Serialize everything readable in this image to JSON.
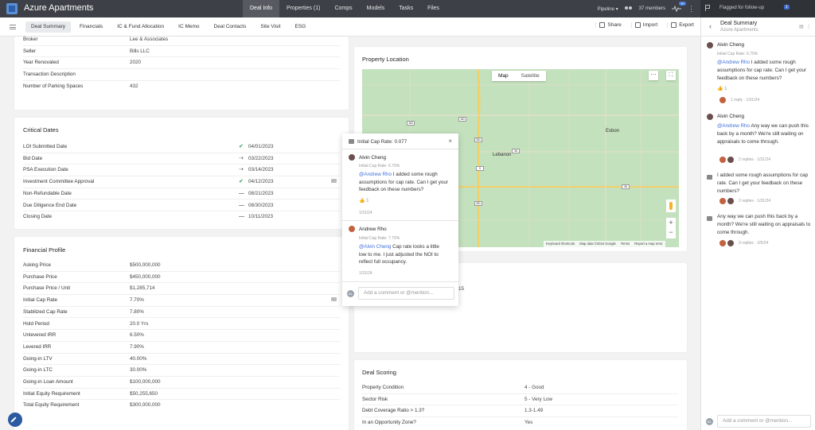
{
  "app": {
    "title": "Azure Apartments"
  },
  "nav": {
    "items": [
      "Deal Info",
      "Properties (1)",
      "Comps",
      "Models",
      "Tasks",
      "Files"
    ],
    "active": "Deal Info"
  },
  "topright": {
    "pipeline": "Pipeline",
    "members": "37 members",
    "notif_count": "9+"
  },
  "followup": {
    "label": "Flagged for follow-up",
    "count": "1"
  },
  "subnav": {
    "tabs": [
      "Deal Summary",
      "Financials",
      "IC & Fund Allocation",
      "IC Memo",
      "Deal Contacts",
      "Site Visit",
      "ESG"
    ],
    "active": "Deal Summary",
    "actions": [
      "Share",
      "Import",
      "Export"
    ]
  },
  "property_info": {
    "rows": [
      {
        "k": "Broker",
        "v": "Lee & Associates"
      },
      {
        "k": "Seller",
        "v": "Bills LLC"
      },
      {
        "k": "Year Renovated",
        "v": "2020"
      },
      {
        "k": "Transaction Description",
        "v": ""
      },
      {
        "k": "Number of Parking Spaces",
        "v": "432"
      }
    ]
  },
  "critical_dates": {
    "title": "Critical Dates",
    "rows": [
      {
        "k": "LOI Submitted Date",
        "status": "check",
        "v": "04/01/2023"
      },
      {
        "k": "Bid Date",
        "status": "arrow",
        "v": "03/22/2023"
      },
      {
        "k": "PSA Execution Date",
        "status": "arrow",
        "v": "03/14/2023"
      },
      {
        "k": "Investment Committee Approval",
        "status": "check",
        "v": "04/12/2023"
      },
      {
        "k": "Non-Refundable Date",
        "status": "dash",
        "v": "08/21/2023"
      },
      {
        "k": "Due Diligence End Date",
        "status": "dash",
        "v": "08/30/2023"
      },
      {
        "k": "Closing Date",
        "status": "dash",
        "v": "10/11/2023"
      }
    ]
  },
  "financial_profile": {
    "title": "Financial Profile",
    "rows": [
      {
        "k": "Asking Price",
        "v": "$500,000,000"
      },
      {
        "k": "Purchase Price",
        "v": "$450,000,000"
      },
      {
        "k": "Purchase Price / Unit",
        "v": "$1,285,714"
      },
      {
        "k": "Initial Cap Rate",
        "v": "7.70%"
      },
      {
        "k": "Stabilized Cap Rate",
        "v": "7.80%"
      },
      {
        "k": "Hold Period",
        "v": "20.0 Yrs"
      },
      {
        "k": "Unlevered IRR",
        "v": "6.50%"
      },
      {
        "k": "Levered IRR",
        "v": "7.90%"
      },
      {
        "k": "Going-in LTV",
        "v": "40.00%"
      },
      {
        "k": "Going-in LTC",
        "v": "30.00%"
      },
      {
        "k": "Going-in Loan Amount",
        "v": "$100,000,000"
      },
      {
        "k": "Initial Equity Requirement",
        "v": "$50,255,650"
      },
      {
        "k": "Total Equity Requirement",
        "v": "$300,000,000"
      }
    ]
  },
  "property_location": {
    "title": "Property Location",
    "toggle": [
      "Map",
      "Satellite"
    ],
    "towns": [
      "Lebanon",
      "Esbon"
    ],
    "shields": [
      "182",
      "181",
      "281",
      "36",
      "9",
      "36",
      "281"
    ],
    "footer": [
      "Keyboard shortcuts",
      "Map data ©2024 Google",
      "Terms",
      "Report a map error"
    ]
  },
  "hidden_card": {
    "partial_text": "15"
  },
  "deal_scoring": {
    "title": "Deal Scoring",
    "rows": [
      {
        "k": "Property Condition",
        "v": "4 - Good"
      },
      {
        "k": "Sector Risk",
        "v": "5 - Very Low"
      },
      {
        "k": "Debt Coverage Ratio > 1.3?",
        "v": "1.3-1.49"
      },
      {
        "k": "In an Opportunity Zone?",
        "v": "Yes"
      }
    ]
  },
  "popover": {
    "title": "Initial Cap Rate: 0.077",
    "comments": [
      {
        "name": "Alvin Cheng",
        "sub": "Initial Cap Rate: 6.70%",
        "mention": "@Andrew Rho",
        "text": " I added some rough assumptions for cap rate. Can I get your feedback on these numbers?",
        "likes": "1",
        "date": "1/31/24"
      },
      {
        "name": "Andrew Rho",
        "sub": "Initial Cap Rate: 7.70%",
        "mention": "@Alvin Cheng",
        "text": " Cap rate looks a little low to me. I just adjusted the NOI to reflect full occupancy.",
        "date": "1/31/24"
      }
    ],
    "input_placeholder": "Add a comment or @mention...",
    "user_initials": "BL"
  },
  "sidebar": {
    "title": "Deal Summary",
    "subtitle": "Azure Apartments",
    "threads": [
      {
        "name": "Alvin Cheng",
        "sub": "Initial Cap Rate: 6.70%",
        "mention": "@Andrew Rho",
        "text": " I added some rough assumptions for cap rate. Can I get your feedback on these numbers?",
        "likes": "1",
        "meta": "1 reply · 1/31/24"
      },
      {
        "name": "Alvin Cheng",
        "sub": "",
        "mention": "@Andrew Rho",
        "text": " Any way we can push this back by a month? We're still waiting on appraisals to come through.",
        "meta": "2 replies · 1/31/24"
      },
      {
        "name": "",
        "text": "I added some rough assumptions for cap rate. Can I get your feedback on these numbers?",
        "meta": "2 replies · 1/31/24"
      },
      {
        "name": "",
        "text": "Any way we can push this back by a month? We're still waiting on appraisals to come through.",
        "meta": "3 replies · 2/5/24"
      }
    ],
    "input_placeholder": "Add a comment or @mention...",
    "user_initials": "BL"
  },
  "colors": {
    "topbar": "#3d4147",
    "accent": "#3d6fd9",
    "check": "#2c9d5a",
    "map": "#c4e1be",
    "road": "#f1cf6b"
  }
}
